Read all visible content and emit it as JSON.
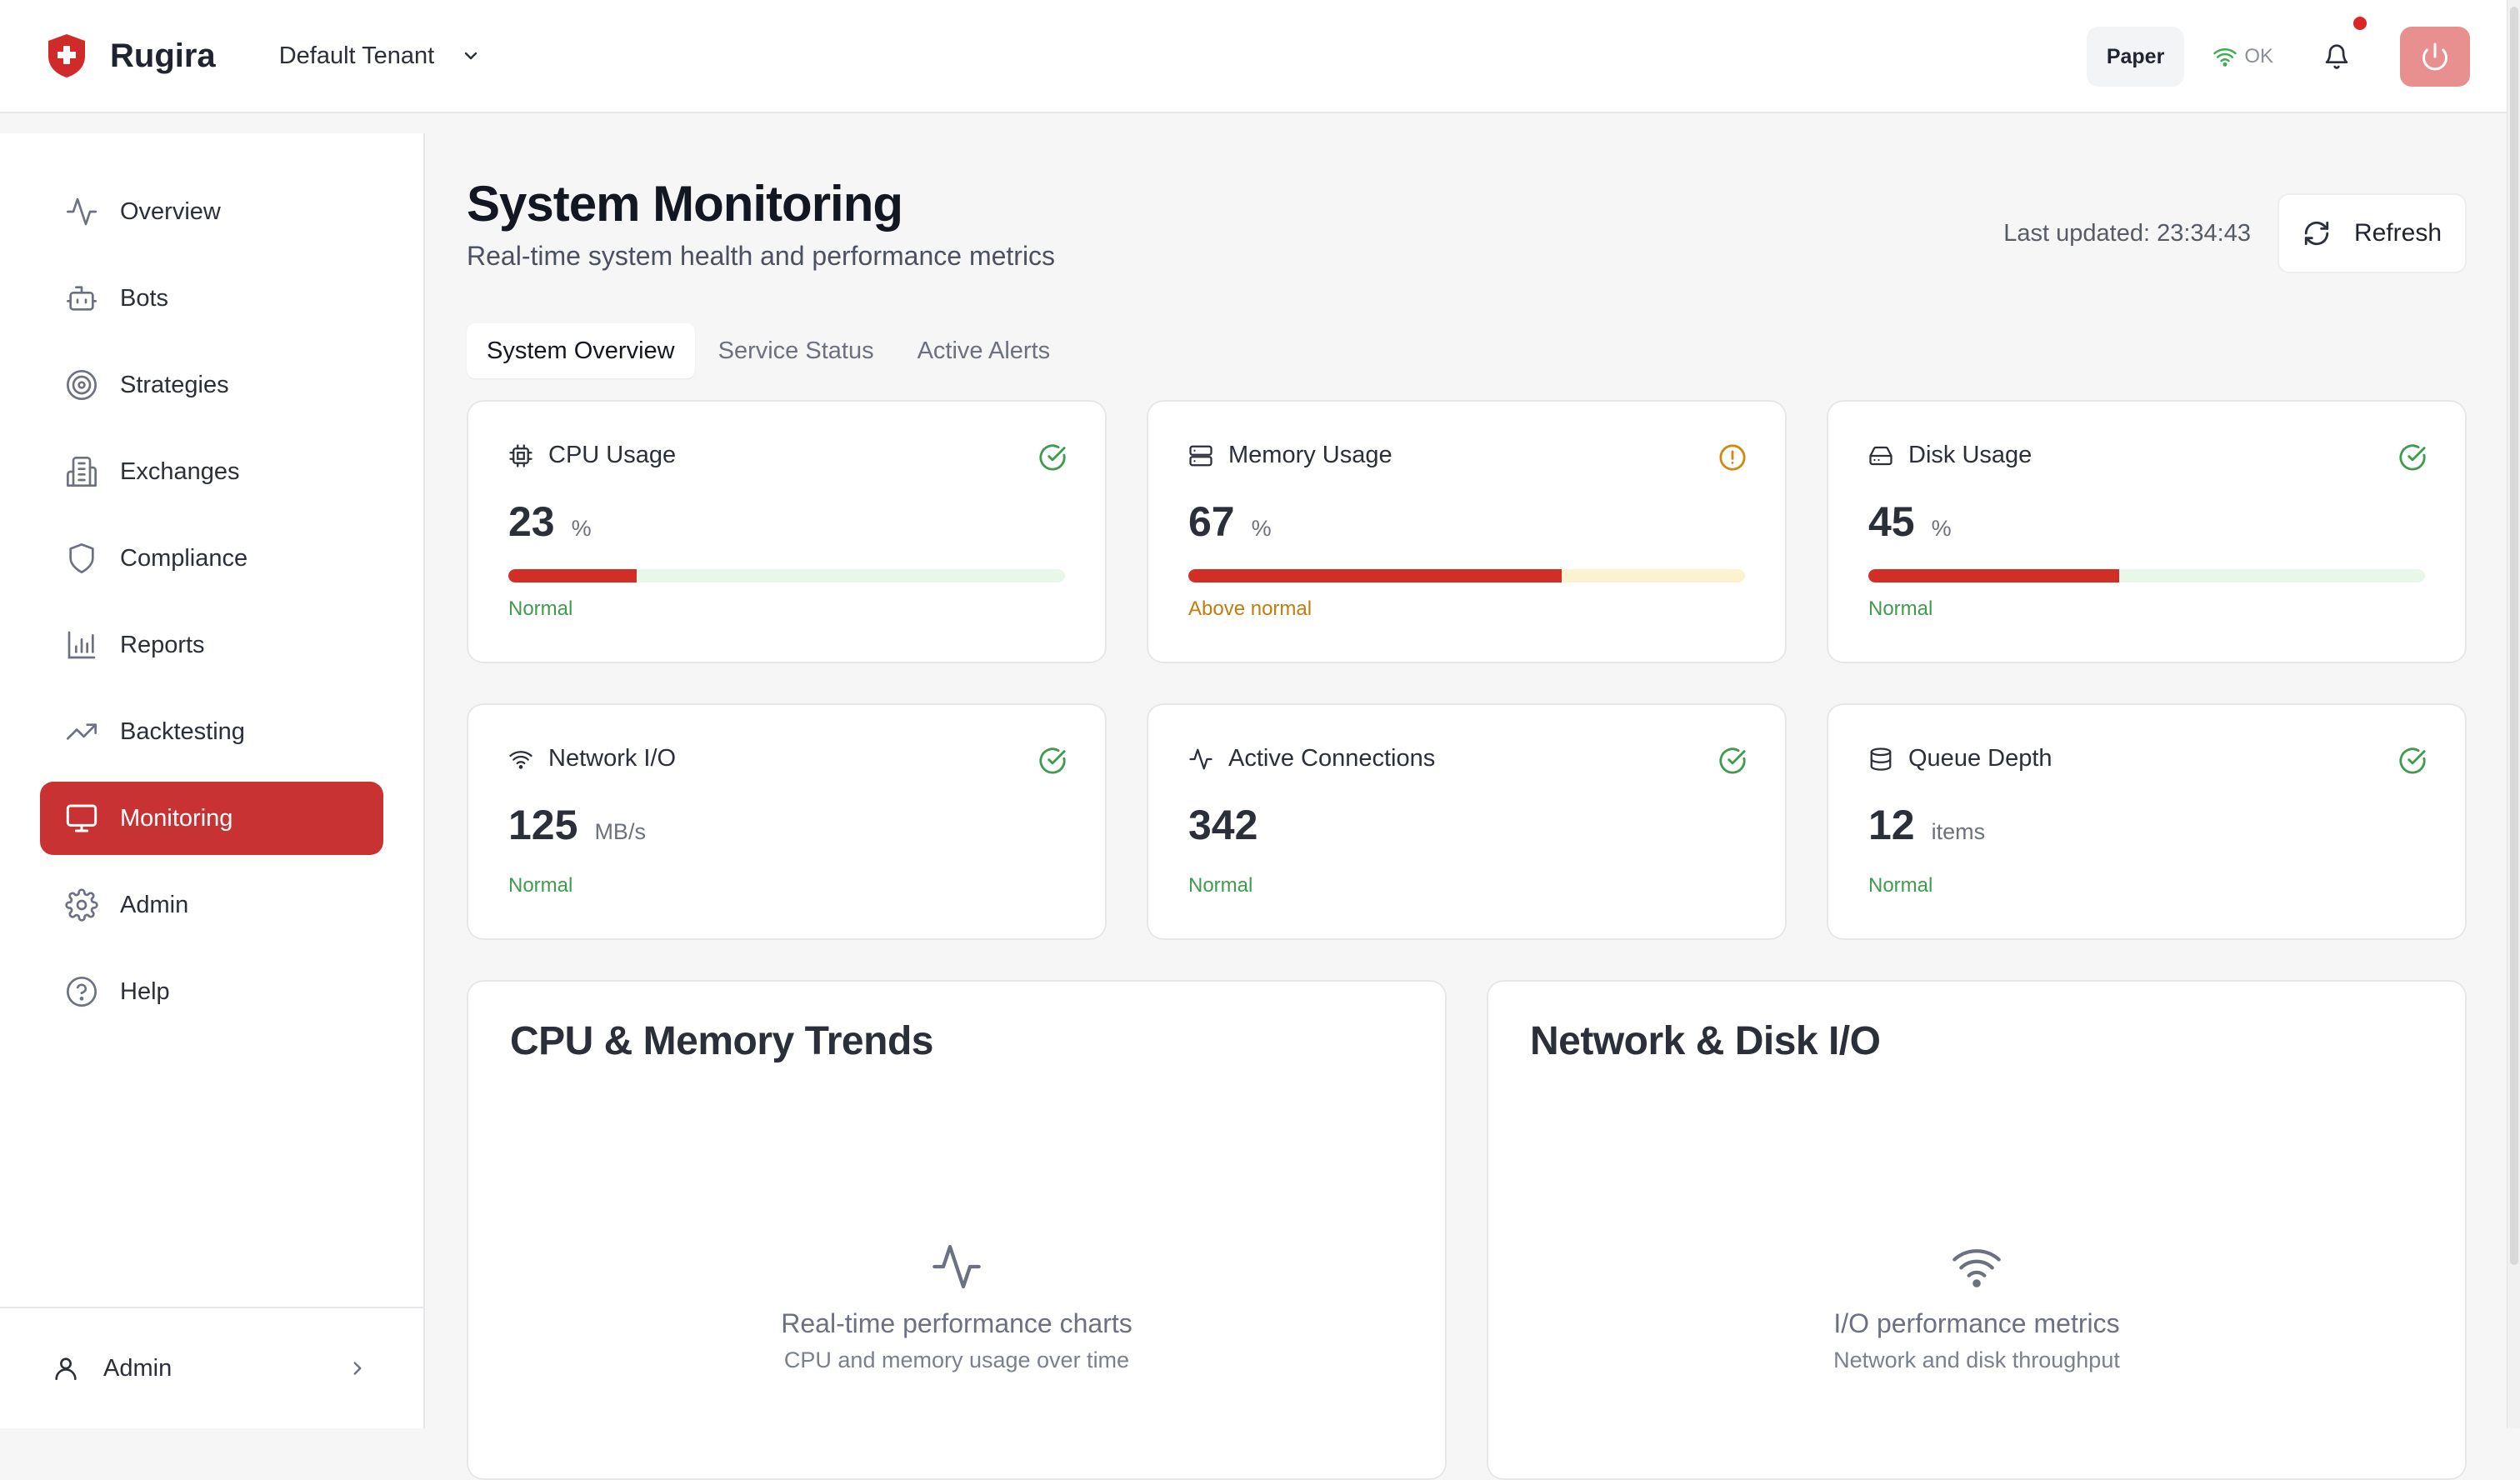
{
  "app": {
    "name": "Rugira",
    "tenant": "Default Tenant"
  },
  "header": {
    "mode_label": "Paper",
    "connection_status": "OK",
    "notification_dot_color": "#dc2626",
    "power_color": "#e88f8f"
  },
  "sidebar": {
    "items": [
      {
        "label": "Overview",
        "icon": "activity-icon"
      },
      {
        "label": "Bots",
        "icon": "bot-icon"
      },
      {
        "label": "Strategies",
        "icon": "target-icon"
      },
      {
        "label": "Exchanges",
        "icon": "building-icon"
      },
      {
        "label": "Compliance",
        "icon": "shield-icon"
      },
      {
        "label": "Reports",
        "icon": "bar-chart-icon"
      },
      {
        "label": "Backtesting",
        "icon": "trending-up-icon"
      },
      {
        "label": "Monitoring",
        "icon": "monitor-icon",
        "active": true
      },
      {
        "label": "Admin",
        "icon": "gear-icon"
      },
      {
        "label": "Help",
        "icon": "help-circle-icon"
      }
    ],
    "user": {
      "name": "Admin"
    }
  },
  "main": {
    "title": "System Monitoring",
    "subtitle": "Real-time system health and performance metrics",
    "last_updated": "Last updated: 23:34:43",
    "refresh_label": "Refresh",
    "tabs": [
      {
        "label": "System Overview",
        "active": true
      },
      {
        "label": "Service Status"
      },
      {
        "label": "Active Alerts"
      }
    ],
    "metrics": [
      {
        "label": "CPU Usage",
        "value": "23",
        "unit": "%",
        "percent": 23,
        "status": "Normal",
        "level": "ok",
        "icon": "cpu-icon"
      },
      {
        "label": "Memory Usage",
        "value": "67",
        "unit": "%",
        "percent": 67,
        "status": "Above normal",
        "level": "warning",
        "icon": "server-icon"
      },
      {
        "label": "Disk Usage",
        "value": "45",
        "unit": "%",
        "percent": 45,
        "status": "Normal",
        "level": "ok",
        "icon": "hard-drive-icon"
      },
      {
        "label": "Network I/O",
        "value": "125",
        "unit": "MB/s",
        "status": "Normal",
        "level": "ok",
        "icon": "wifi-icon"
      },
      {
        "label": "Active Connections",
        "value": "342",
        "unit": "",
        "status": "Normal",
        "level": "ok",
        "icon": "activity-icon"
      },
      {
        "label": "Queue Depth",
        "value": "12",
        "unit": "items",
        "status": "Normal",
        "level": "ok",
        "icon": "database-icon"
      }
    ],
    "charts": [
      {
        "title": "CPU & Memory Trends",
        "placeholder_title": "Real-time performance charts",
        "placeholder_sub": "CPU and memory usage over time",
        "icon": "activity-icon"
      },
      {
        "title": "Network & Disk I/O",
        "placeholder_title": "I/O performance metrics",
        "placeholder_sub": "Network and disk throughput",
        "icon": "wifi-icon"
      }
    ]
  },
  "colors": {
    "accent": "#c83232",
    "ok": "#3f9b4d",
    "warning": "#c27c0e",
    "bar_fill": "#d12f26"
  }
}
